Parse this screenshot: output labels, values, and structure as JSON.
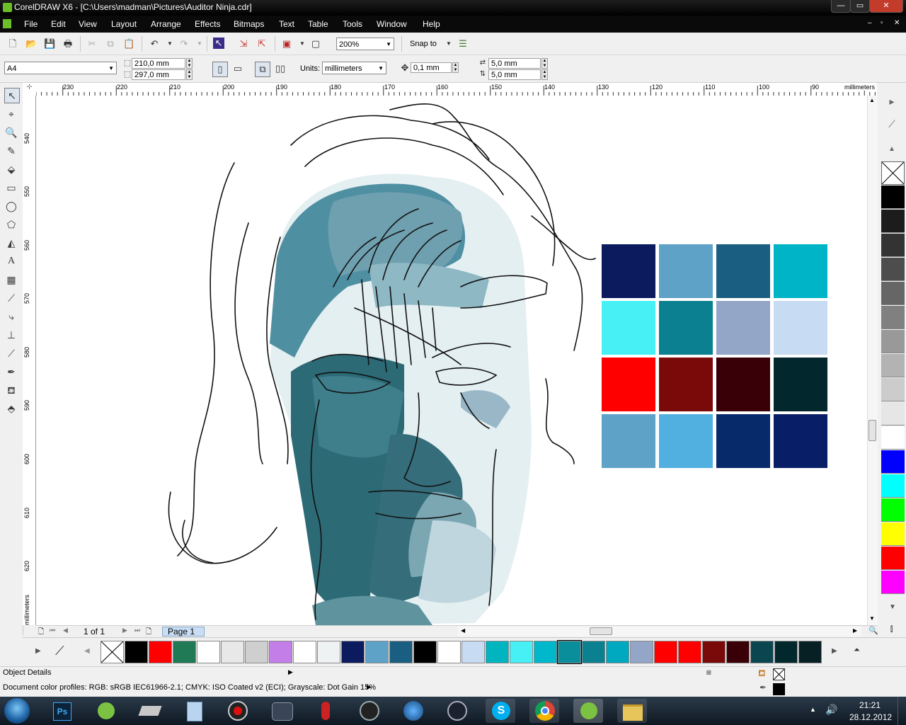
{
  "window": {
    "title": "CorelDRAW X6 - [C:\\Users\\madman\\Pictures\\Auditor Ninja.cdr]",
    "minimize": "—",
    "maximize": "▭",
    "close": "✕"
  },
  "menu": [
    {
      "label": "File"
    },
    {
      "label": "Edit"
    },
    {
      "label": "View"
    },
    {
      "label": "Layout"
    },
    {
      "label": "Arrange"
    },
    {
      "label": "Effects"
    },
    {
      "label": "Bitmaps"
    },
    {
      "label": "Text"
    },
    {
      "label": "Table"
    },
    {
      "label": "Tools"
    },
    {
      "label": "Window"
    },
    {
      "label": "Help"
    }
  ],
  "toolbar": {
    "zoom_value": "200%",
    "snap_to_label": "Snap to"
  },
  "property_bar": {
    "page_size": "A4",
    "width": "210,0 mm",
    "height": "297,0 mm",
    "units_label": "Units:",
    "units_value": "millimeters",
    "nudge": "0,1 mm",
    "dup_x": "5,0 mm",
    "dup_y": "5,0 mm"
  },
  "ruler": {
    "top_ticks": [
      "230",
      "220",
      "210",
      "200",
      "190",
      "180",
      "170",
      "160",
      "150",
      "140",
      "130",
      "120",
      "110",
      "100",
      "90"
    ],
    "top_unit": "millimeters",
    "left_ticks": [
      "540",
      "550",
      "560",
      "570",
      "580",
      "590",
      "600",
      "610",
      "620"
    ],
    "left_unit": "millimeters"
  },
  "page_nav": {
    "page_count": "1 of 1",
    "page_tab": "Page 1"
  },
  "palette_colors": [
    "#000000",
    "#ff0000",
    "#1f7a55",
    "#ffffff",
    "#e8e8e8",
    "#cfcfcf",
    "#c47ee8",
    "#ffffff",
    "#eef2f2",
    "#0c1a5e",
    "#5fa2c8",
    "#1a5f82",
    "#000000",
    "#ffffff",
    "#c7dbf2",
    "#00b4c0",
    "#47f0f5",
    "#00b8cc",
    "#0a8e9c",
    "#0a8090",
    "#00a8c0",
    "#94a6c8",
    "#ff0000",
    "#ff0000",
    "#7a0a0a",
    "#3a0008",
    "#0a4550",
    "#02282e",
    "#062024"
  ],
  "swatch_grid": {
    "colors": [
      "#0c1a5e",
      "#5fa2c8",
      "#1a5f82",
      "#00b4c8",
      "#47f0f5",
      "#0a8090",
      "#94a6c8",
      "#c7dbf2",
      "#ff0000",
      "#7a0a0a",
      "#3a0008",
      "#02282e",
      "#5fa2c8",
      "#52b0e0",
      "#072a6a",
      "#081e66"
    ]
  },
  "color_strip": [
    "#000000",
    "#1c1c1c",
    "#333333",
    "#4d4d4d",
    "#666666",
    "#808080",
    "#999999",
    "#b3b3b3",
    "#cccccc",
    "#e6e6e6",
    "#ffffff",
    "#0000ff",
    "#00ffff",
    "#00ff00",
    "#ffff00",
    "#ff0000",
    "#ff00ff"
  ],
  "status": {
    "object_details": "Object Details",
    "color_profiles": "Document color profiles: RGB: sRGB IEC61966-2.1; CMYK: ISO Coated v2 (ECI); Grayscale: Dot Gain 15%"
  },
  "taskbar": {
    "time": "21:21",
    "date": "28.12.2012",
    "ps_label": "Ps"
  }
}
